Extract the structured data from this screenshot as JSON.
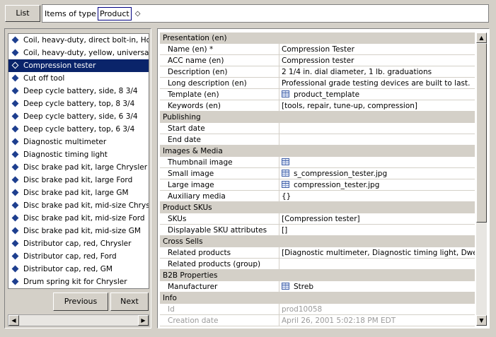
{
  "toolbar": {
    "list_label": "List",
    "type_label": "Items of type",
    "type_value": "Product",
    "type_suffix": "◇"
  },
  "items": [
    {
      "label": "Coil, heavy-duty, direct bolt-in, Honda",
      "selected": false
    },
    {
      "label": "Coil, heavy-duty, yellow, universal",
      "selected": false
    },
    {
      "label": "Compression tester",
      "selected": true
    },
    {
      "label": "Cut off tool",
      "selected": false
    },
    {
      "label": "Deep cycle battery,  side, 8 3/4",
      "selected": false
    },
    {
      "label": "Deep cycle battery,  top, 8 3/4",
      "selected": false
    },
    {
      "label": "Deep cycle battery, side, 6 3/4",
      "selected": false
    },
    {
      "label": "Deep cycle battery, top, 6 3/4",
      "selected": false
    },
    {
      "label": "Diagnostic multimeter",
      "selected": false
    },
    {
      "label": "Diagnostic timing light",
      "selected": false
    },
    {
      "label": "Disc brake pad kit, large Chrysler",
      "selected": false
    },
    {
      "label": "Disc brake pad kit, large Ford",
      "selected": false
    },
    {
      "label": "Disc brake pad kit, large GM",
      "selected": false
    },
    {
      "label": "Disc brake pad kit, mid-size Chrysler",
      "selected": false
    },
    {
      "label": "Disc brake pad kit, mid-size Ford",
      "selected": false
    },
    {
      "label": "Disc brake pad kit, mid-size GM",
      "selected": false
    },
    {
      "label": "Distributor cap, red, Chrysler",
      "selected": false
    },
    {
      "label": "Distributor cap, red, Ford",
      "selected": false
    },
    {
      "label": "Distributor cap, red, GM",
      "selected": false
    },
    {
      "label": "Drum spring kit for Chrysler",
      "selected": false
    }
  ],
  "nav": {
    "previous_label": "Previous",
    "next_label": "Next"
  },
  "properties": [
    {
      "section": "Presentation (en)"
    },
    {
      "key": "Name (en) *",
      "value": "Compression Tester"
    },
    {
      "key": "ACC name (en)",
      "value": "Compression tester"
    },
    {
      "key": "Description (en)",
      "value": "2 1/4 in. dial diameter, 1 lb. graduations"
    },
    {
      "key": "Long description (en)",
      "value": "Professional grade testing devices are built to last."
    },
    {
      "key": "Template (en)",
      "value": "product_template",
      "icon": "table-icon"
    },
    {
      "key": "Keywords (en)",
      "value": "[tools, repair, tune-up, compression]"
    },
    {
      "section": "Publishing"
    },
    {
      "key": "Start date",
      "value": ""
    },
    {
      "key": "End date",
      "value": ""
    },
    {
      "section": "Images & Media"
    },
    {
      "key": "Thumbnail image",
      "value": "",
      "icon": "table-icon"
    },
    {
      "key": "Small image",
      "value": "s_compression_tester.jpg",
      "icon": "table-icon"
    },
    {
      "key": "Large image",
      "value": "compression_tester.jpg",
      "icon": "table-icon"
    },
    {
      "key": "Auxiliary media",
      "value": "{}"
    },
    {
      "section": "Product SKUs"
    },
    {
      "key": "SKUs",
      "value": "[Compression tester]"
    },
    {
      "key": "Displayable SKU attributes",
      "value": "[]"
    },
    {
      "section": "Cross Sells"
    },
    {
      "key": "Related products",
      "value": "[Diagnostic multimeter, Diagnostic timing light, Dwell ..."
    },
    {
      "key": "Related products (group)",
      "value": ""
    },
    {
      "section": "B2B Properties"
    },
    {
      "key": "Manufacturer",
      "value": "Streb",
      "icon": "table-icon"
    },
    {
      "section": "Info"
    },
    {
      "key": "Id",
      "value": "prod10058",
      "dim": true
    },
    {
      "key": "Creation date",
      "value": "April 26, 2001 5:02:18 PM EDT",
      "dim": true
    }
  ],
  "colors": {
    "selection": "#0a246a",
    "bullet": "#1e3f8f",
    "chrome": "#d4d0c8"
  }
}
